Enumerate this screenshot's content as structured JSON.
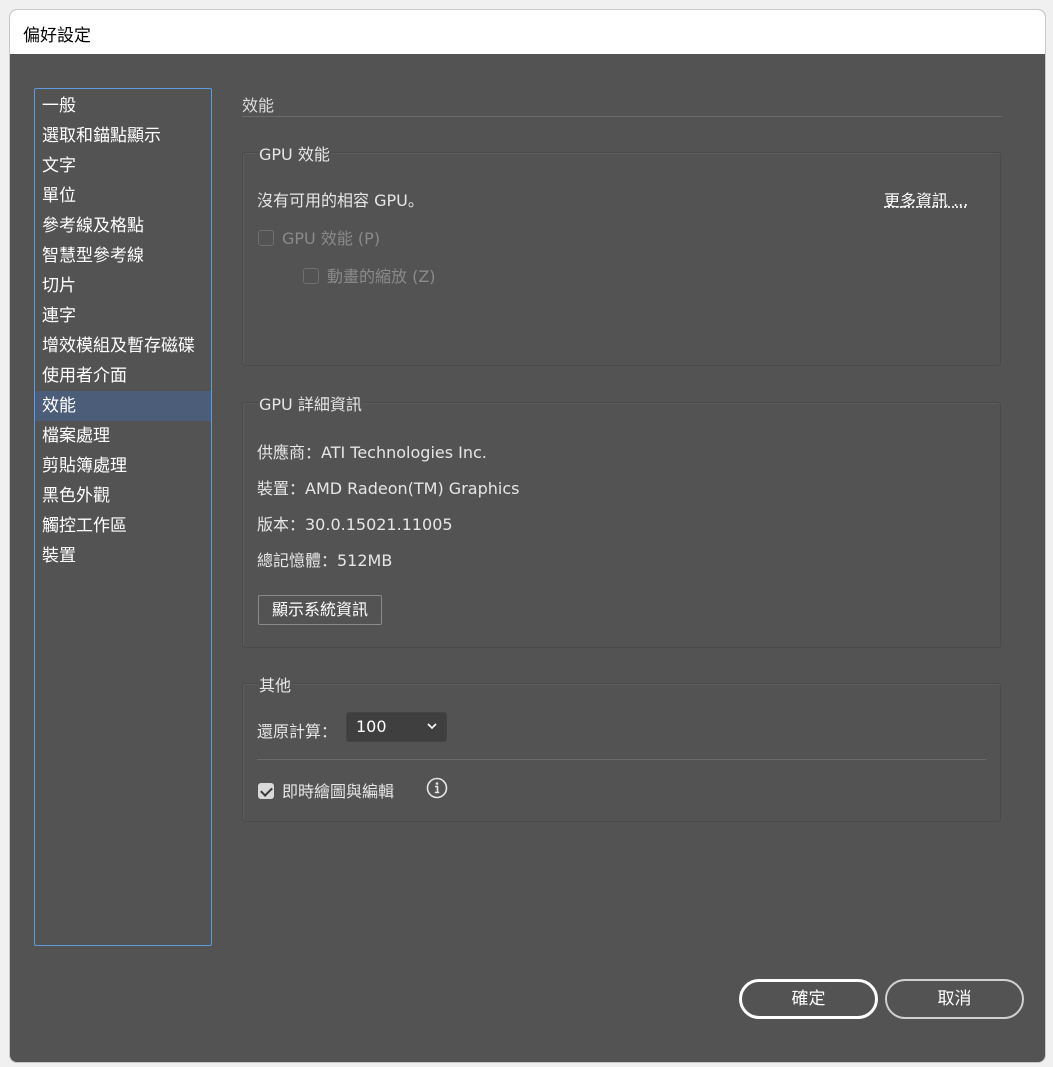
{
  "window": {
    "title": "偏好設定"
  },
  "sidebar": {
    "items": [
      {
        "label": "一般"
      },
      {
        "label": "選取和錨點顯示"
      },
      {
        "label": "文字"
      },
      {
        "label": "單位"
      },
      {
        "label": "參考線及格點"
      },
      {
        "label": "智慧型參考線"
      },
      {
        "label": "切片"
      },
      {
        "label": "連字"
      },
      {
        "label": "增效模組及暫存磁碟"
      },
      {
        "label": "使用者介面"
      },
      {
        "label": "效能",
        "selected": true
      },
      {
        "label": "檔案處理"
      },
      {
        "label": "剪貼簿處理"
      },
      {
        "label": "黑色外觀"
      },
      {
        "label": "觸控工作區"
      },
      {
        "label": "裝置"
      }
    ]
  },
  "main": {
    "section_title": "效能",
    "gpu_performance": {
      "title": "GPU 效能",
      "status": "沒有可用的相容 GPU。",
      "more_info": "更多資訊 ...",
      "gpu_checkbox_label": "GPU 效能 (P)",
      "gpu_checkbox_checked": false,
      "animated_zoom_label": "動畫的縮放 (Z)",
      "animated_zoom_checked": false
    },
    "gpu_details": {
      "title": "GPU 詳細資訊",
      "vendor": "供應商：ATI Technologies Inc.",
      "device": "裝置：AMD Radeon(TM) Graphics",
      "version": "版本：30.0.15021.11005",
      "memory": "總記憶體：512MB",
      "system_info_button": "顯示系統資訊"
    },
    "other": {
      "title": "其他",
      "undo_label": "還原計算：",
      "undo_value": "100",
      "live_draw_label": "即時繪圖與編輯",
      "live_draw_checked": true
    }
  },
  "footer": {
    "ok_label": "確定",
    "cancel_label": "取消"
  },
  "colors": {
    "panel_bg": "#535353",
    "selected_item": "#4b5d78",
    "sidebar_border": "#5b9be0",
    "text": "#e6e6e6",
    "disabled_text": "#8a8a8a"
  },
  "icons": [
    "checkbox-icon",
    "chevron-down-icon",
    "info-icon"
  ]
}
